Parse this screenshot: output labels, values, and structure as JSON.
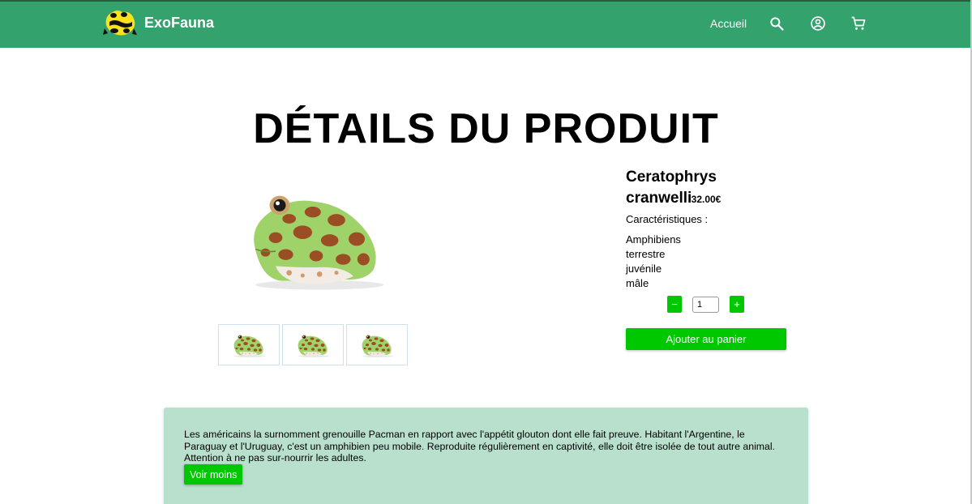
{
  "brand": {
    "name": "ExoFauna",
    "logo": "poison-dart-frog-logo"
  },
  "nav": {
    "home_label": "Accueil",
    "icons": [
      "search-icon",
      "account-icon",
      "cart-icon"
    ]
  },
  "page": {
    "title": "DÉTAILS DU PRODUIT"
  },
  "product": {
    "name": "Ceratophrys cranwelli",
    "price": "32.00€",
    "characteristics_label": "Caractéristiques :",
    "characteristics": [
      "Amphibiens",
      "terrestre",
      "juvénile",
      "mâle"
    ],
    "quantity": "1",
    "minus_label": "−",
    "plus_label": "+",
    "add_to_cart_label": "Ajouter au panier",
    "thumbnail_count": 3
  },
  "description": {
    "text": "Les américains la surnomment grenouille Pacman en rapport avec l'appétit glouton dont elle fait preuve. Habitant l'Argentine, le Paraguay et l'Uruguay, c'est un amphibien peu mobile. Reproduite régulièrement en captivité, elle doit être isolée de tout autre animal. Attention à ne pas sur-nourrir les adultes.",
    "toggle_label": "Voir moins"
  },
  "colors": {
    "navbar": "#33a26d",
    "accent_button": "#00c800",
    "description_bg": "#b8e0cc"
  }
}
